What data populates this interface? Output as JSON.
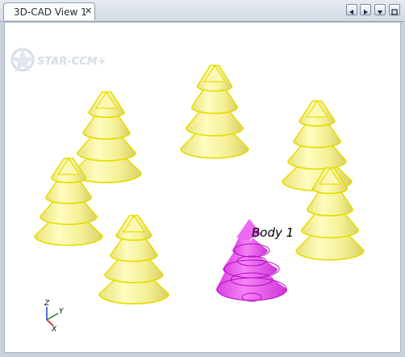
{
  "tab": {
    "label": "3D-CAD View 1",
    "close_glyph": "✕"
  },
  "nav_buttons": [
    {
      "name": "scroll-tabs-left-button",
      "icon": "triangle-left-icon"
    },
    {
      "name": "scroll-tabs-right-button",
      "icon": "triangle-right-icon"
    },
    {
      "name": "tab-list-dropdown-button",
      "icon": "triangle-down-icon"
    },
    {
      "name": "maximize-view-button",
      "icon": "maximize-icon"
    }
  ],
  "viewport": {
    "logo_text": "STAR-CCM+",
    "selected_body_label": "Body 1",
    "colors": {
      "tree_fill": "#f6f49a",
      "tree_edge": "#e6dd00",
      "selected_fill": "#ec3cf0",
      "selected_edge": "#c000d0"
    },
    "axes": {
      "z": "Z",
      "y": "Y",
      "x": "X"
    }
  }
}
